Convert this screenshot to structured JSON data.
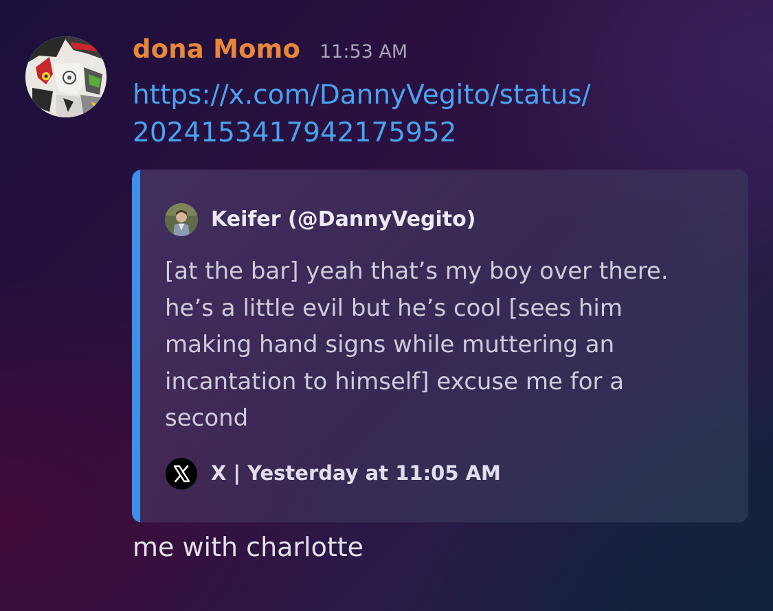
{
  "message": {
    "username": "dona Momo",
    "timestamp": "11:53 AM",
    "link_lines": [
      "https://x.com/DannyVegito/status/",
      "2024153417942175952"
    ],
    "followup_text": "me with charlotte",
    "username_color": "#e8873a",
    "link_color": "#4aa3ee"
  },
  "embed": {
    "author": "Keifer (@DannyVegito)",
    "text_lines": [
      "[at the bar] yeah that’s my boy over there.",
      "he’s a little evil but he’s cool [sees him",
      "making hand signs while muttering an",
      "incantation to himself] excuse me for a",
      "second"
    ],
    "footer": "X | Yesterday at 11:05 AM",
    "accent_color": "#3d8fe8",
    "icons": {
      "author_avatar": "author-avatar",
      "source": "x-logo-icon"
    }
  },
  "icons": {
    "user_avatar": "avatar"
  }
}
